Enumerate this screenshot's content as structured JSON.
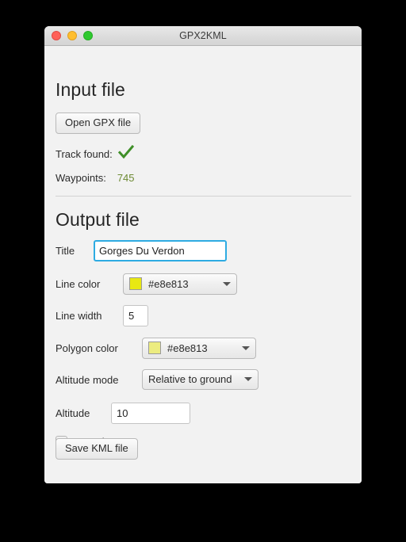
{
  "window": {
    "title": "GPX2KML",
    "traffic_lights": [
      {
        "name": "close",
        "color": "#ff6159"
      },
      {
        "name": "minimize",
        "color": "#ffbe2f"
      },
      {
        "name": "maximize",
        "color": "#2fc92f"
      }
    ]
  },
  "input_section": {
    "heading": "Input file",
    "open_button": "Open GPX file",
    "track_found_label": "Track found:",
    "track_found_icon": "green-check-icon",
    "track_found_color": "#3f8f28",
    "waypoints_label": "Waypoints:",
    "waypoints_value": "745",
    "waypoints_value_color": "#6d8a33"
  },
  "output_section": {
    "heading": "Output file",
    "title": {
      "label": "Title",
      "value": "Gorges Du Verdon",
      "placeholder": "",
      "focused": true,
      "focus_color": "#2eabe2"
    },
    "line_color": {
      "label": "Line color",
      "value": "#e8e813",
      "swatch": "#e8e813"
    },
    "line_width": {
      "label": "Line width",
      "value": "5",
      "placeholder": ""
    },
    "polygon_color": {
      "label": "Polygon color",
      "value": "#e8e813",
      "swatch": "#ecec80"
    },
    "altitude_mode": {
      "label": "Altitude mode",
      "value": "Relative to ground"
    },
    "altitude": {
      "label": "Altitude",
      "value": "10",
      "placeholder": ""
    },
    "extrude": {
      "label": "Extrude",
      "checked": false
    },
    "save_button": "Save KML file"
  }
}
